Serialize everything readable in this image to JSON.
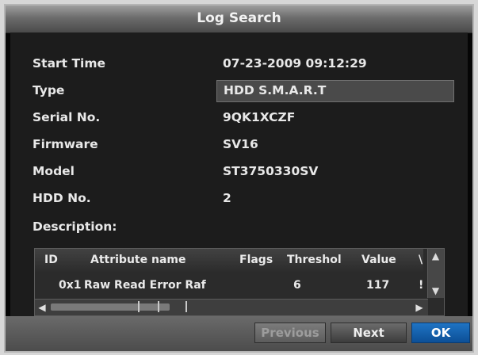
{
  "dialog": {
    "title": "Log Search"
  },
  "fields": [
    {
      "label": "Start Time",
      "value": "07-23-2009 09:12:29"
    },
    {
      "label": "Type",
      "value": "HDD S.M.A.R.T"
    },
    {
      "label": "Serial No.",
      "value": "9QK1XCZF"
    },
    {
      "label": "Firmware",
      "value": "SV16"
    },
    {
      "label": "Model",
      "value": "ST3750330SV"
    },
    {
      "label": "HDD No.",
      "value": "2"
    }
  ],
  "description_label": "Description:",
  "table": {
    "columns": [
      "ID",
      "Attribute name",
      "Flags",
      "Threshol",
      "Value",
      "\\"
    ],
    "rows": [
      [
        "0x1",
        "Raw Read Error Raf",
        "",
        "6",
        "117",
        "!"
      ]
    ]
  },
  "scroll_icons": {
    "up": "chevron-up-icon",
    "down": "chevron-down-icon",
    "left": "chevron-left-icon",
    "right": "chevron-right-icon"
  },
  "buttons": {
    "previous": "Previous",
    "next": "Next",
    "ok": "OK"
  }
}
